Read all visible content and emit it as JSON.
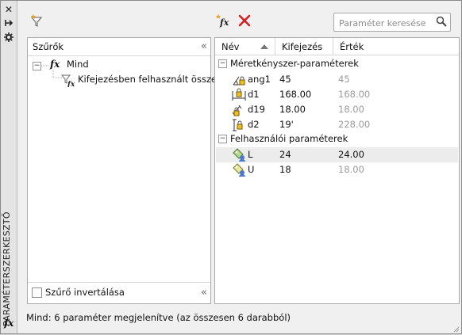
{
  "palette": {
    "title": "PARAMÉTERSZERKESZTŐ",
    "close_glyph": "✕",
    "pin_glyph": "⊢",
    "props_glyph": "⚙",
    "fx_glyph": "fx"
  },
  "toolbar": {
    "filter_icon": "funnel-star-icon",
    "new_param_icon": "new-fx-icon",
    "delete_icon": "delete-x-icon",
    "search_placeholder": "Paraméter keresése"
  },
  "filters": {
    "header": "Szűrők",
    "collapse_glyph": "«",
    "tree": [
      {
        "label": "Mind",
        "icon": "fx-icon",
        "expander": "−"
      },
      {
        "label": "Kifejezésben felhasznált összes",
        "icon": "filter-fx-icon"
      }
    ],
    "invert_label": "Szűrő invertálása",
    "invert_checked": false
  },
  "grid": {
    "columns": [
      "Név",
      "Kifejezés",
      "Érték"
    ],
    "groups": [
      {
        "label": "Méretkényszer-paraméterek",
        "expander": "−",
        "rows": [
          {
            "name": "ang1",
            "expr": "45",
            "value": "45",
            "icon": "angular-lock-icon"
          },
          {
            "name": "d1",
            "expr": "168.00",
            "value": "168.00",
            "icon": "linear-lock-icon"
          },
          {
            "name": "d19",
            "expr": "18.00",
            "value": "18.00",
            "icon": "aligned-lock-icon"
          },
          {
            "name": "d2",
            "expr": "19'",
            "value": "228.00",
            "icon": "vertical-lock-icon"
          }
        ]
      },
      {
        "label": "Felhasználói paraméterek",
        "expander": "−",
        "rows": [
          {
            "name": "L",
            "expr": "24",
            "value": "24.00",
            "icon": "user-param-icon",
            "selected": true
          },
          {
            "name": "U",
            "expr": "18",
            "value": "18.00",
            "icon": "user-param-icon"
          }
        ]
      }
    ]
  },
  "status": "Mind: 6 paraméter megjelenítve (az összesen 6 darabból)"
}
